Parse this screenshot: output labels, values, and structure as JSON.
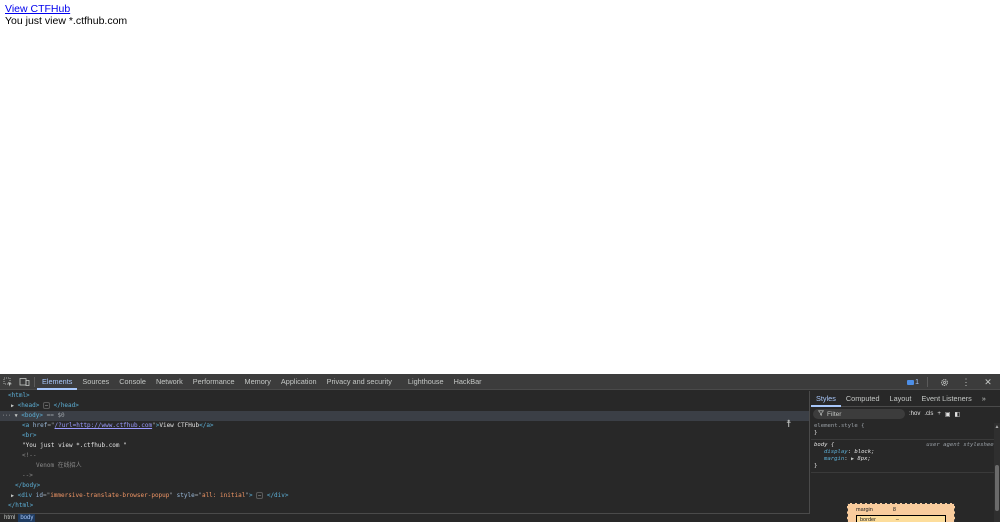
{
  "page": {
    "link_text": "View CTFHub",
    "body_text": "You just view *.ctfhub.com"
  },
  "devtools": {
    "tabs": [
      "Elements",
      "Sources",
      "Console",
      "Network",
      "Performance",
      "Memory",
      "Application",
      "Privacy and security",
      "Lighthouse",
      "HackBar"
    ],
    "active_tab": "Elements",
    "message_count": "1",
    "dom": {
      "html_open": "<html>",
      "head": "<head>",
      "head_close": "</head>",
      "body_open": "<body>",
      "body_eq": "== $0",
      "a_tag_open": "<a",
      "a_attr": "href",
      "a_href": "/?url=http://www.ctfhub.com",
      "a_text": "View CTFHub",
      "a_close": "</a>",
      "br": "<br>",
      "text_node": "\"You just view *.ctfhub.com \"",
      "comment_open": "<!--",
      "comment_text": "Venom 在线招人",
      "comment_close": "-->",
      "body_close": "</body>",
      "div_open": "<div",
      "div_id_attr": "id",
      "div_id": "immersive-translate-browser-popup",
      "div_style_attr": "style",
      "div_style": "all: initial",
      "div_close": "</div>",
      "html_close": "</html>"
    },
    "breadcrumbs": [
      "html",
      "body"
    ],
    "styles": {
      "tabs": [
        "Styles",
        "Computed",
        "Layout",
        "Event Listeners"
      ],
      "active_tab": "Styles",
      "filter_placeholder": "Filter",
      "hov": ":hov",
      "cls": ".cls",
      "element_style_selector": "element.style {",
      "element_style_close": "}",
      "body_selector": "body {",
      "ua_label": "user agent stylesheet",
      "rules": [
        {
          "prop": "display",
          "value": "block;"
        },
        {
          "prop": "margin",
          "value": "8px;"
        }
      ],
      "body_close": "}",
      "box_model": {
        "margin_label": "margin",
        "margin_value": "8",
        "border_label": "border",
        "border_value": "–"
      }
    }
  }
}
